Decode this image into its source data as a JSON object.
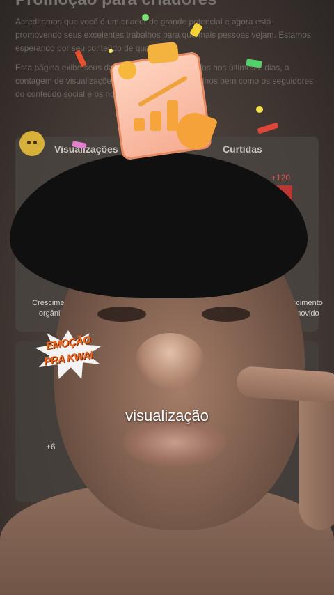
{
  "promo": {
    "title": "Promoção para criadores",
    "paragraph1": "Acreditamos que você é um criador de grande potencial e agora está promovendo seus excelentes trabalhos para que mais pessoas vejam. Estamos esperando por seu conteúdo de qualidade!",
    "paragraph2": "Esta página exibe seus dados de vídeos promovidos nos últimos 2 dias, a contagem de visualizações e curtidas destes trabalhos bem como os seguidores do conteúdo social e os novos seguidores obtidos.",
    "tab_left": "Visualizações",
    "tab_right": "Curtidas",
    "stat_plus": "+120",
    "stat_small": "+6",
    "label_left": "Crescimento orgânico",
    "label_right": "Crescimento promovido"
  },
  "badge": {
    "line1": "EMOÇÃO",
    "line2": "PRA KWAI"
  },
  "caption": "visualização",
  "colors": {
    "badge_text": "#ee6a1e",
    "stat_red": "#d9534f",
    "caption": "#ffffff"
  },
  "icons": [
    "clipboard-growth-icon",
    "megaphone-icon",
    "emoji-avatar-icon"
  ]
}
